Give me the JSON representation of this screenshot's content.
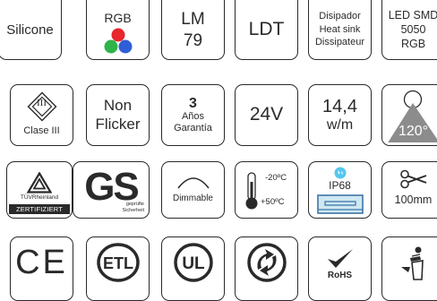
{
  "colors": {
    "ink": "#2a2a2a",
    "red": "#e8262b",
    "green": "#2fb34a",
    "blue": "#2f5fd6",
    "grey_cone": "#8c8c8c",
    "ip_badge": "#54c7ee",
    "heatsink_box": "#3f76a9"
  },
  "icons": [
    {
      "key": "silicone",
      "label": "Silicone"
    },
    {
      "key": "rgb",
      "label": "RGB",
      "icon": "rgb-dots-icon"
    },
    {
      "key": "lm79",
      "line1": "LM",
      "line2": "79"
    },
    {
      "key": "ldt",
      "label": "LDT"
    },
    {
      "key": "heatsink",
      "line1": "Disipador",
      "line2": "Heat sink",
      "line3": "Dissipateur"
    },
    {
      "key": "smd",
      "line1": "LED SMD",
      "line2": "5050",
      "line3": "RGB"
    },
    {
      "key": "clase3",
      "symbol": "III",
      "label": "Clase III",
      "icon": "class-iii-diamond-icon"
    },
    {
      "key": "flicker",
      "line1": "Non",
      "line2": "Flicker"
    },
    {
      "key": "warranty",
      "line1": "3",
      "line2": "Años",
      "line3": "Garantía"
    },
    {
      "key": "voltage",
      "label": "24V"
    },
    {
      "key": "power",
      "line1": "14,4",
      "line2": "w/m"
    },
    {
      "key": "angle",
      "label": "120°",
      "icon": "beam-angle-icon"
    },
    {
      "key": "tuv",
      "line1": "TÜVRheinland",
      "line2": "ZERTIFIZIERT",
      "gs_text": "GS",
      "gs_sub1": "geprüfte",
      "gs_sub2": "Sicherheit"
    },
    {
      "key": "dimmable",
      "label": "Dimmable",
      "icon": "dimmer-arc-icon"
    },
    {
      "key": "temp",
      "top": "-20ºC",
      "bottom": "+50ºC",
      "icon": "thermometer-icon"
    },
    {
      "key": "ip68",
      "label": "IP68",
      "icon": "water-drop-icon"
    },
    {
      "key": "cut",
      "label": "100mm",
      "icon": "scissors-icon"
    },
    {
      "key": "ce",
      "label": "CE"
    },
    {
      "key": "etl",
      "label": "ETL",
      "icon": "etl-logo-icon"
    },
    {
      "key": "ul",
      "label": "UL",
      "icon": "ul-logo-icon"
    },
    {
      "key": "recycle",
      "icon": "green-dot-icon"
    },
    {
      "key": "rohs",
      "label": "RoHS",
      "icon": "rohs-check-icon"
    },
    {
      "key": "weee",
      "icon": "weee-bin-icon"
    }
  ]
}
